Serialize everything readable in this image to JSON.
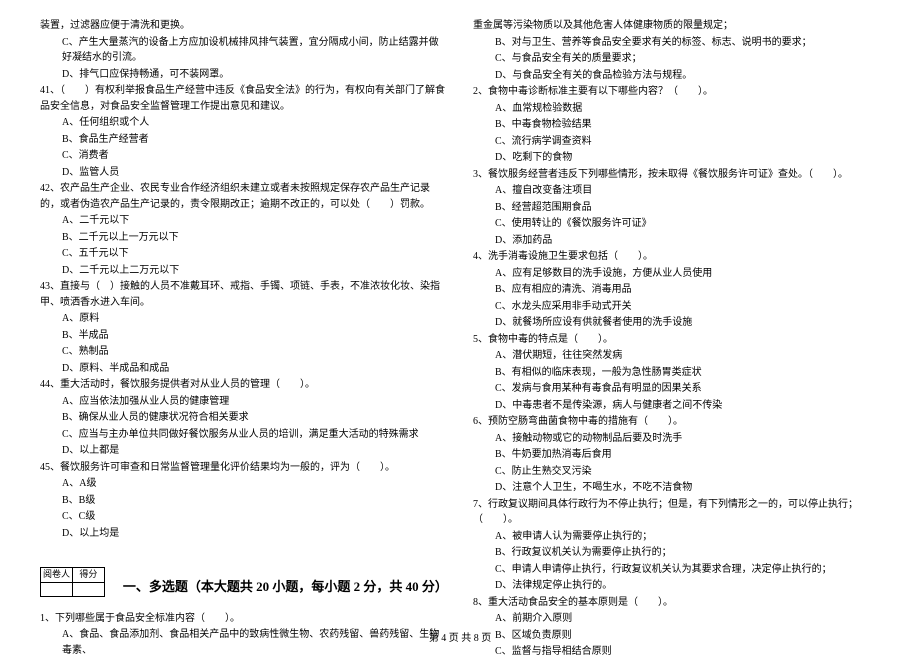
{
  "leftColumn": {
    "pretext_a": "装置，过滤器应便于清洗和更换。",
    "pretext_b": "C、产生大量蒸汽的设备上方应加设机械排风排气装置，宜分隔成小间，防止结露并做好凝结水的引流。",
    "pretext_c": "D、排气口应保持畅通，可不装网罩。",
    "q41": {
      "stem": "41、（　　）有权利举报食品生产经营中违反《食品安全法》的行为，有权向有关部门了解食品安全信息，对食品安全监督管理工作提出意见和建议。",
      "A": "A、任何组织或个人",
      "B": "B、食品生产经营者",
      "C": "C、消费者",
      "D": "D、监管人员"
    },
    "q42": {
      "stem": "42、农产品生产企业、农民专业合作经济组织未建立或者未按照规定保存农产品生产记录的，或者伪造农产品生产记录的，责令限期改正；逾期不改正的，可以处（　　）罚款。",
      "A": "A、二千元以下",
      "B": "B、二千元以上一万元以下",
      "C": "C、五千元以下",
      "D": "D、二千元以上二万元以下"
    },
    "q43": {
      "stem": "43、直接与（　）接触的人员不准戴耳环、戒指、手镯、项链、手表，不准浓妆化妆、染指甲、喷洒香水进入车间。",
      "A": "A、原料",
      "B": "B、半成品",
      "C": "C、熟制品",
      "D": "D、原料、半成品和成品"
    },
    "q44": {
      "stem": "44、重大活动时，餐饮服务提供者对从业人员的管理（　　）。",
      "A": "A、应当依法加强从业人员的健康管理",
      "B": "B、确保从业人员的健康状况符合相关要求",
      "C": "C、应当与主办单位共同做好餐饮服务从业人员的培训，满足重大活动的特殊需求",
      "D": "D、以上都是"
    },
    "q45": {
      "stem": "45、餐饮服务许可审查和日常监督管理量化评价结果均为一般的，评为（　　）。",
      "A": "A、A级",
      "B": "B、B级",
      "C": "C、C级",
      "D": "D、以上均是"
    },
    "multiSection": {
      "scoreHeader1": "阅卷人",
      "scoreHeader2": "得分",
      "title": "一、多选题（本大题共 20 小题，每小题 2 分，共 40 分）"
    },
    "mq1": {
      "stem": "1、下列哪些属于食品安全标准内容（　　）。",
      "A": "A、食品、食品添加剂、食品相关产品中的致病性微生物、农药残留、兽药残留、生物毒素、"
    }
  },
  "rightColumn": {
    "cont_a": "重金属等污染物质以及其他危害人体健康物质的限量规定；",
    "cont_b": "B、对与卫生、营养等食品安全要求有关的标签、标志、说明书的要求；",
    "cont_c": "C、与食品安全有关的质量要求；",
    "cont_d": "D、与食品安全有关的食品检验方法与规程。",
    "q2": {
      "stem": "2、食物中毒诊断标准主要有以下哪些内容？（　　）。",
      "A": "A、血常规检验数据",
      "B": "B、中毒食物检验结果",
      "C": "C、流行病学调查资料",
      "D": "D、吃剩下的食物"
    },
    "q3": {
      "stem": "3、餐饮服务经营者违反下列哪些情形，按未取得《餐饮服务许可证》查处。（　　）。",
      "A": "A、擅自改变备注项目",
      "B": "B、经营超范围期食品",
      "C": "C、使用转让的《餐饮服务许可证》",
      "D": "D、添加药品"
    },
    "q4": {
      "stem": "4、洗手消毒设施卫生要求包括（　　）。",
      "A": "A、应有足够数目的洗手设施，方便从业人员使用",
      "B": "B、应有相应的清洗、消毒用品",
      "C": "C、水龙头应采用非手动式开关",
      "D": "D、就餐场所应设有供就餐者使用的洗手设施"
    },
    "q5": {
      "stem": "5、食物中毒的特点是（　　）。",
      "A": "A、潜伏期短，往往突然发病",
      "B": "B、有相似的临床表现，一般为急性肠胃类症状",
      "C": "C、发病与食用某种有毒食品有明显的因果关系",
      "D": "D、中毒患者不是传染源，病人与健康者之间不传染"
    },
    "q6": {
      "stem": "6、预防空肠弯曲菌食物中毒的措施有（　　）。",
      "A": "A、接触动物或它的动物制品后要及时洗手",
      "B": "B、牛奶要加热消毒后食用",
      "C": "C、防止生熟交叉污染",
      "D": "D、注意个人卫生，不喝生水，不吃不洁食物"
    },
    "q7": {
      "stem": "7、行政复议期间具体行政行为不停止执行；但是，有下列情形之一的，可以停止执行；（　　）。",
      "A": "A、被申请人认为需要停止执行的；",
      "B": "B、行政复议机关认为需要停止执行的；",
      "C": "C、申请人申请停止执行，行政复议机关认为其要求合理，决定停止执行的；",
      "D": "D、法律规定停止执行的。"
    },
    "q8": {
      "stem": "8、重大活动食品安全的基本原则是（　　）。",
      "A": "A、前期介入原则",
      "B": "B、区域负责原则",
      "C": "C、监督与指导相结合原则"
    }
  },
  "footer": "第 4 页  共 8 页"
}
